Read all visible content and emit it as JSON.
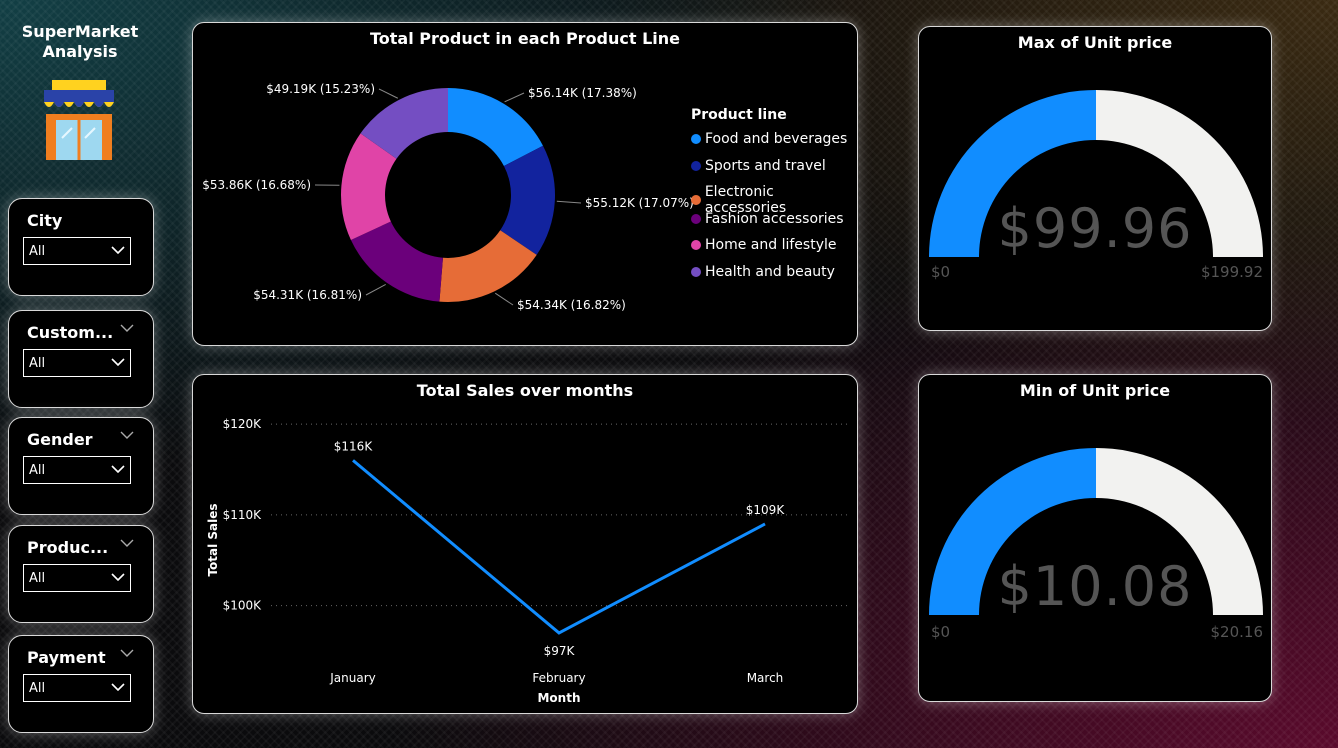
{
  "app": {
    "title_line1": "SuperMarket",
    "title_line2": "Analysis",
    "icon": "store-icon"
  },
  "slicers": [
    {
      "title": "City",
      "value": "All",
      "has_chevron": false
    },
    {
      "title": "Custom...",
      "value": "All",
      "has_chevron": true
    },
    {
      "title": "Gender",
      "value": "All",
      "has_chevron": true
    },
    {
      "title": "Produc...",
      "value": "All",
      "has_chevron": true
    },
    {
      "title": "Payment",
      "value": "All",
      "has_chevron": true
    }
  ],
  "donut": {
    "title": "Total Product in each Product Line",
    "legend_title": "Product line",
    "labels": [
      "$56.14K (17.38%)",
      "$55.12K (17.07%)",
      "$54.34K (16.82%)",
      "$54.31K (16.81%)",
      "$53.86K (16.68%)",
      "$49.19K (15.23%)"
    ]
  },
  "line": {
    "title": "Total Sales over months"
  },
  "gauge_max": {
    "title": "Max of Unit price",
    "value_label": "$99.96",
    "min_label": "$0",
    "max_label": "$199.92",
    "value": 99.96,
    "max": 199.92
  },
  "gauge_min": {
    "title": "Min of Unit price",
    "value_label": "$10.08",
    "min_label": "$0",
    "max_label": "$20.16",
    "value": 10.08,
    "max": 20.16
  },
  "colors": {
    "accent_blue": "#118DFF",
    "gauge_track": "#F2F2F0",
    "panel_border": "#D9D9D9"
  },
  "chart_data": [
    {
      "type": "pie",
      "title": "Total Product in each Product Line",
      "legend_title": "Product line",
      "legend_position": "right",
      "categories": [
        "Food and beverages",
        "Sports and travel",
        "Electronic accessories",
        "Fashion accessories",
        "Home and lifestyle",
        "Health and beauty"
      ],
      "values": [
        56.14,
        55.12,
        54.34,
        54.31,
        53.86,
        49.19
      ],
      "percentages": [
        17.38,
        17.07,
        16.82,
        16.81,
        16.68,
        15.23
      ],
      "colors": [
        "#118DFF",
        "#12239E",
        "#E66C37",
        "#6B007B",
        "#E044A7",
        "#744EC2"
      ],
      "donut": true
    },
    {
      "type": "line",
      "title": "Total Sales over months",
      "xlabel": "Month",
      "ylabel": "Total Sales",
      "categories": [
        "January",
        "February",
        "March"
      ],
      "values": [
        116,
        97,
        109
      ],
      "data_labels": [
        "$116K",
        "$97K",
        "$109K"
      ],
      "y_ticks": [
        100,
        110,
        120
      ],
      "y_tick_labels": [
        "$100K",
        "$110K",
        "$120K"
      ],
      "ylim": [
        96,
        121
      ],
      "grid": true,
      "color": "#118DFF"
    }
  ]
}
